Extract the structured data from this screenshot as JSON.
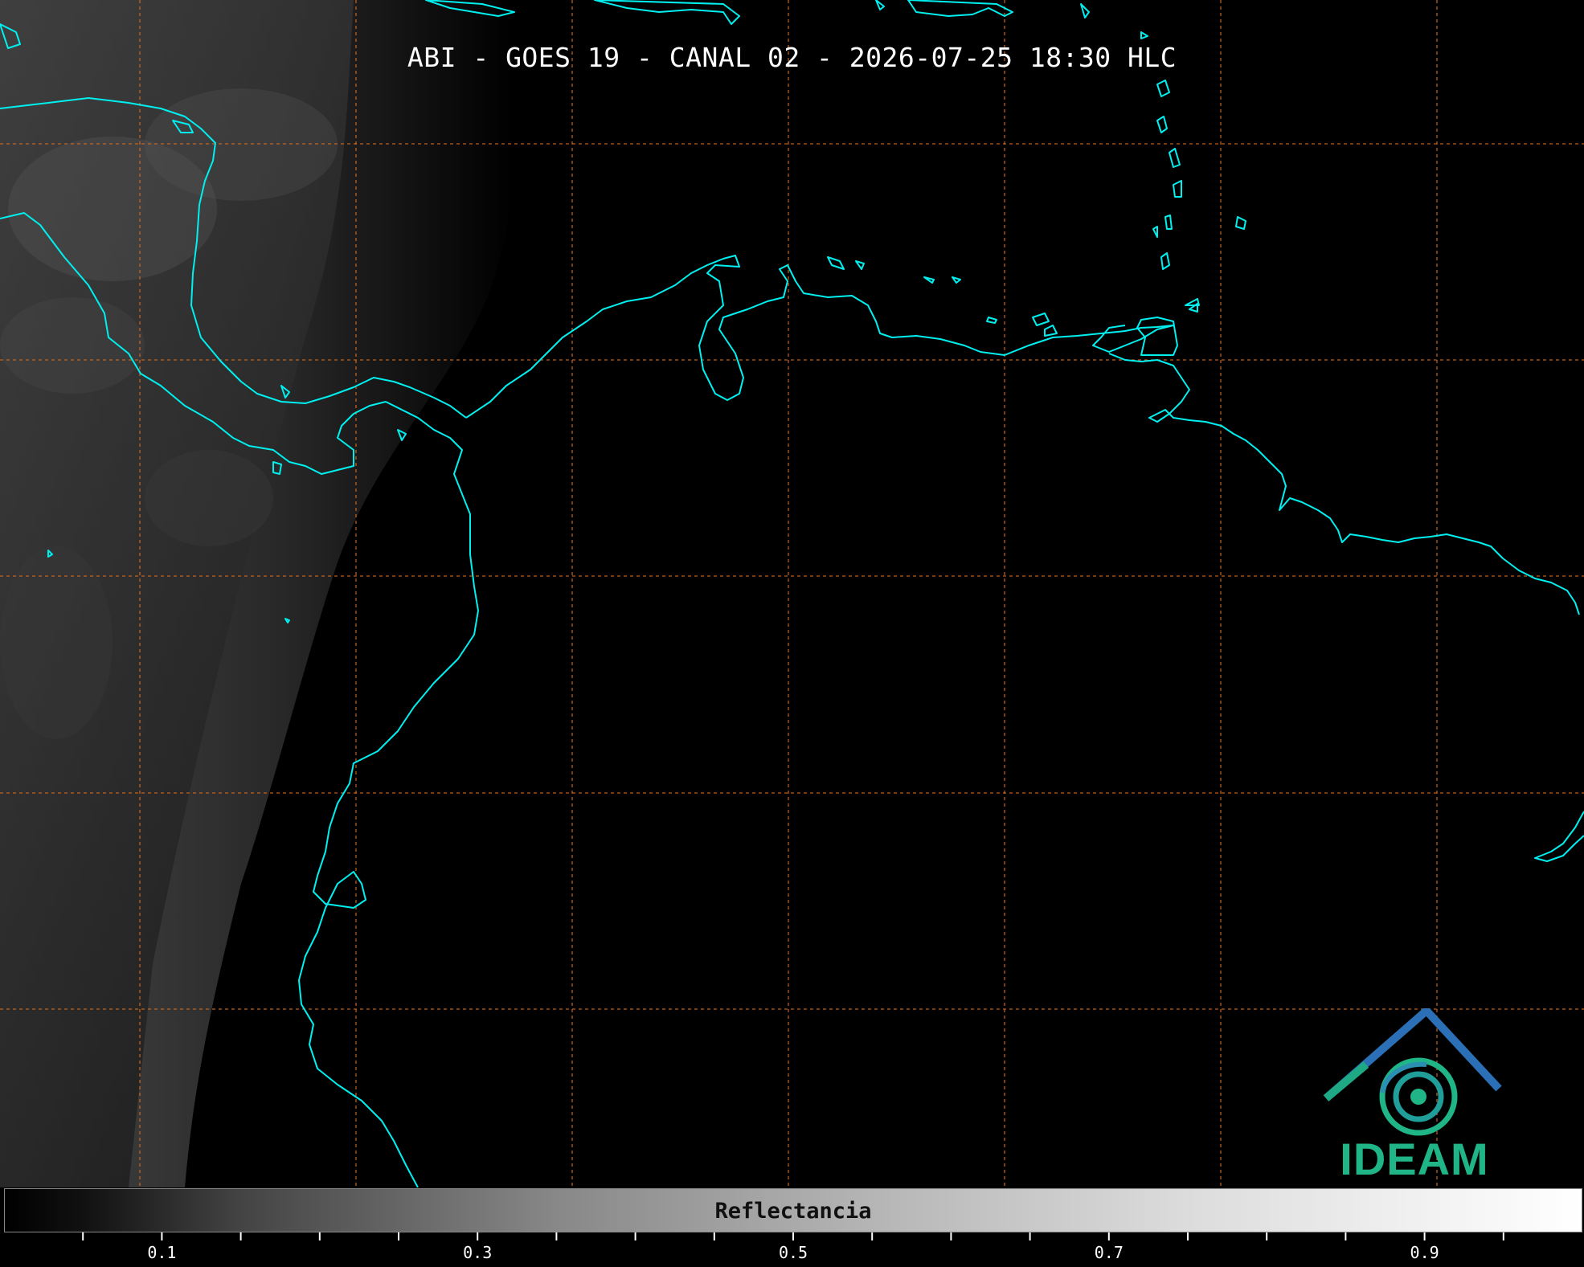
{
  "title": "ABI - GOES 19 - CANAL 02 - 2026-07-25 18:30 HLC",
  "colorbar": {
    "label": "Reflectancia",
    "ticks": [
      "0.1",
      "0.3",
      "0.5",
      "0.7",
      "0.9"
    ],
    "major_values": [
      0.1,
      0.3,
      0.5,
      0.7,
      0.9
    ],
    "range": [
      0.05,
      1.0
    ]
  },
  "logo": {
    "text": "IDEAM",
    "icon": "ideam-logo-icon"
  },
  "colors": {
    "coastline": "#00f0f0",
    "gridlines": "#d2691e",
    "background": "#000000",
    "logo_green": "#20b586",
    "logo_blue": "#2b6fb6"
  }
}
